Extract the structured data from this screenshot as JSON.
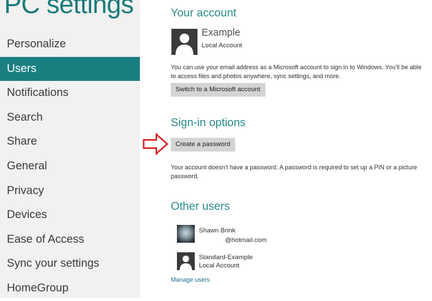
{
  "app": {
    "title": "PC settings"
  },
  "sidebar": {
    "items": [
      {
        "label": "Personalize",
        "selected": false
      },
      {
        "label": "Users",
        "selected": true
      },
      {
        "label": "Notifications",
        "selected": false
      },
      {
        "label": "Search",
        "selected": false
      },
      {
        "label": "Share",
        "selected": false
      },
      {
        "label": "General",
        "selected": false
      },
      {
        "label": "Privacy",
        "selected": false
      },
      {
        "label": "Devices",
        "selected": false
      },
      {
        "label": "Ease of Access",
        "selected": false
      },
      {
        "label": "Sync your settings",
        "selected": false
      },
      {
        "label": "HomeGroup",
        "selected": false
      }
    ]
  },
  "account": {
    "heading": "Your account",
    "name": "Example",
    "type": "Local Account",
    "description": "You can use your email address as a Microsoft account to sign in to Windows. You'll be able to access files and photos anywhere, sync settings, and more.",
    "switch_button": "Switch to a Microsoft account"
  },
  "signin": {
    "heading": "Sign-in options",
    "create_password_button": "Create a password",
    "note": "Your account doesn't have a password. A password is required to set up a PIN or a picture password."
  },
  "other_users": {
    "heading": "Other users",
    "users": [
      {
        "name": "Shawn Brink",
        "detail": "@hotmail.com"
      },
      {
        "name": "Standard-Example",
        "detail": "Local Account"
      }
    ],
    "manage_link": "Manage users"
  },
  "colors": {
    "accent": "#1a7f80",
    "heading": "#2a8a8a",
    "arrow": "#d62020",
    "sidebar_bg": "#f1f1f1"
  },
  "icons": {
    "user_avatar": "person-silhouette-icon",
    "pointer": "red-outline-arrow-icon"
  }
}
